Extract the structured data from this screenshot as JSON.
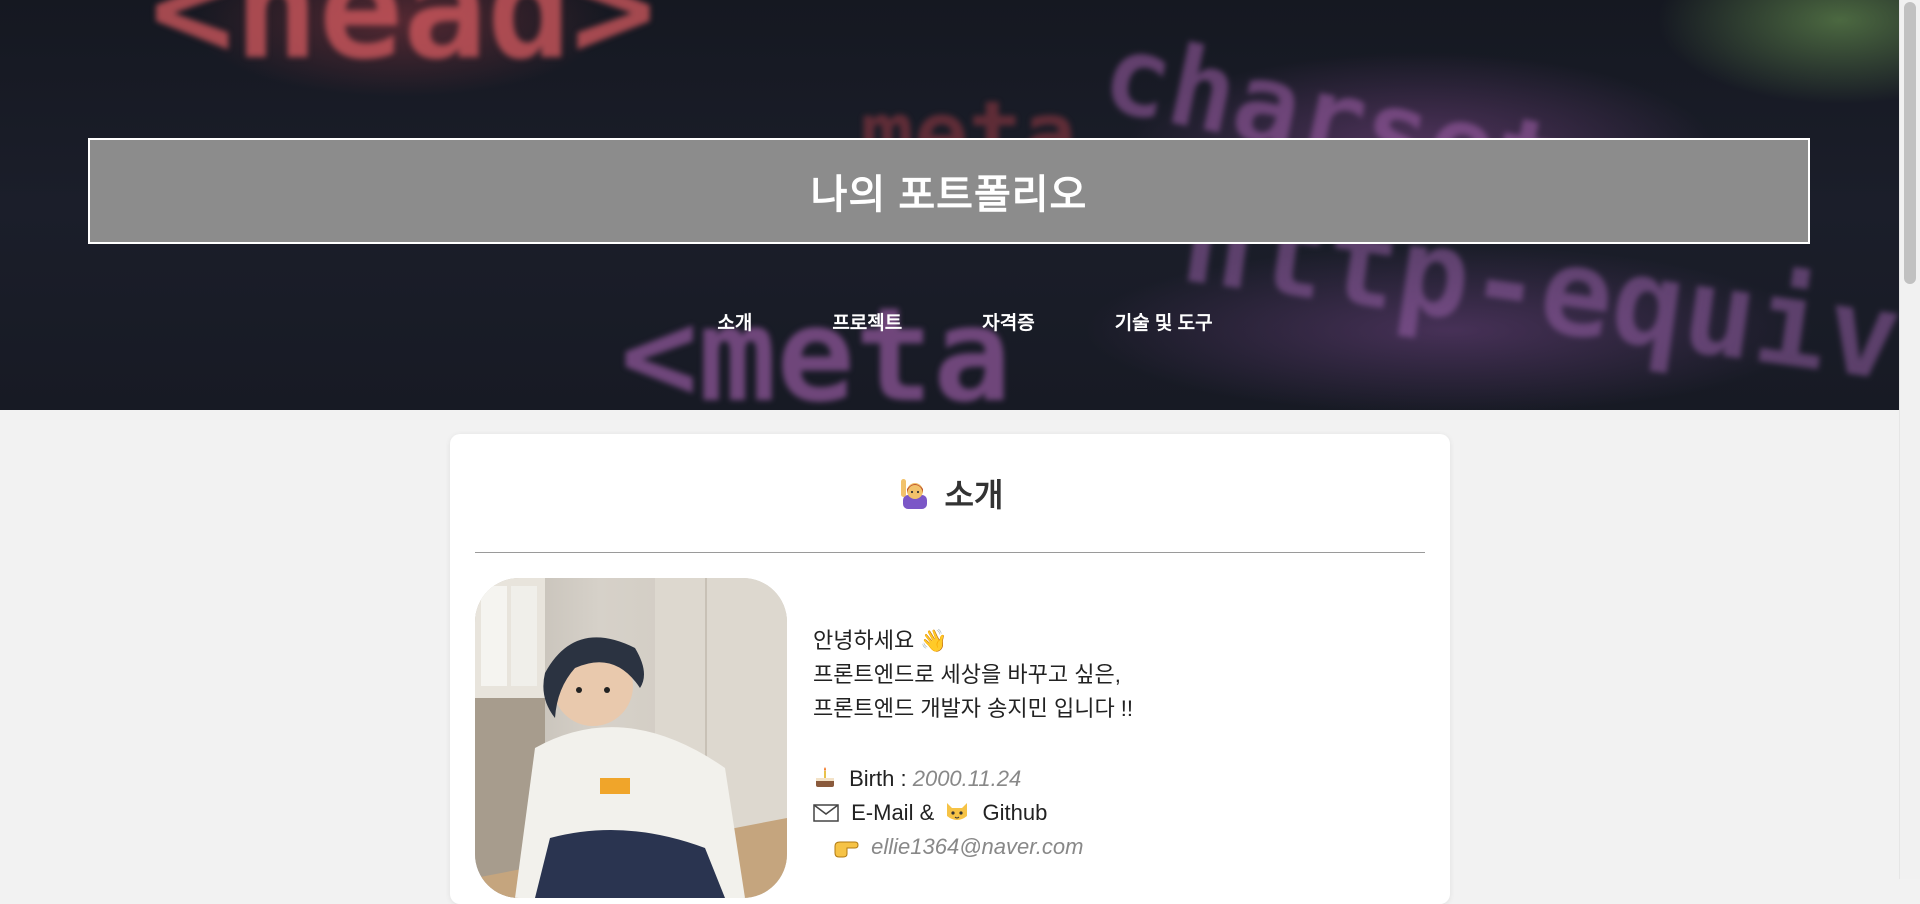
{
  "header": {
    "title": "나의 포트폴리오",
    "code_words": [
      "<head>",
      "charset=",
      "<meta",
      "http-equiv",
      "meta"
    ]
  },
  "nav": {
    "items": [
      {
        "label": "소개"
      },
      {
        "label": "프로젝트"
      },
      {
        "label": "자격증"
      },
      {
        "label": "기술 및 도구"
      }
    ]
  },
  "intro": {
    "heading": "소개",
    "heading_icon": "person-raising-hand-emoji",
    "greeting": "안녕하세요 👋",
    "line2": "프론트엔드로 세상을 바꾸고 싶은,",
    "line3": "프론트엔드 개발자 송지민 입니다 !!",
    "birth_label": "Birth :",
    "birth_value": "2000.11.24",
    "contact_label_email": "E-Mail &",
    "contact_label_github": "Github",
    "email": "ellie1364@naver.com",
    "icons": [
      "cake-emoji",
      "envelope-emoji",
      "cat-emoji",
      "pointing-hand-emoji"
    ]
  },
  "colors": {
    "title_box_bg": "#8c8c8c",
    "page_bg": "#f2f2f2",
    "value_text": "#888888"
  }
}
